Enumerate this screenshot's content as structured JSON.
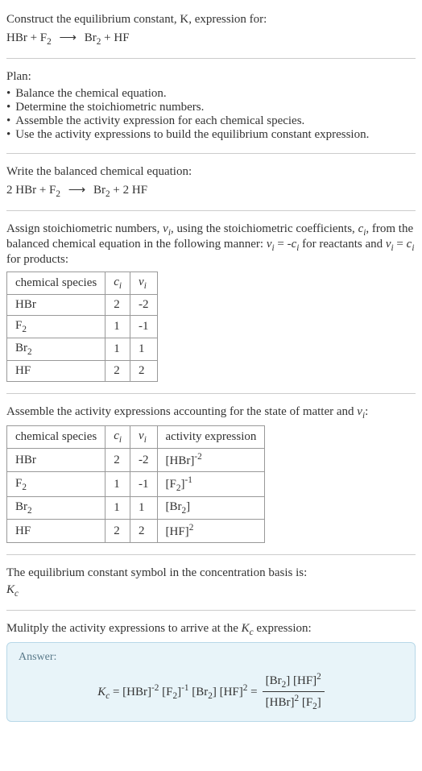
{
  "prompt": {
    "line1": "Construct the equilibrium constant, K, expression for:"
  },
  "plan": {
    "heading": "Plan:",
    "items": [
      "Balance the chemical equation.",
      "Determine the stoichiometric numbers.",
      "Assemble the activity expression for each chemical species.",
      "Use the activity expressions to build the equilibrium constant expression."
    ]
  },
  "balanced": {
    "heading": "Write the balanced chemical equation:"
  },
  "stoich": {
    "heading_pre": "Assign stoichiometric numbers, ",
    "heading_mid1": ", using the stoichiometric coefficients, ",
    "heading_mid2": ", from the balanced chemical equation in the following manner: ",
    "heading_r": " for reactants and ",
    "heading_p": " for products:",
    "table": {
      "headers": [
        "chemical species",
        "cᵢ",
        "νᵢ"
      ],
      "rows": [
        {
          "species": "HBr",
          "c": "2",
          "v": "-2"
        },
        {
          "species": "F₂",
          "c": "1",
          "v": "-1"
        },
        {
          "species": "Br₂",
          "c": "1",
          "v": "1"
        },
        {
          "species": "HF",
          "c": "2",
          "v": "2"
        }
      ]
    }
  },
  "activity": {
    "heading_pre": "Assemble the activity expressions accounting for the state of matter and ",
    "heading_post": ":",
    "table": {
      "headers": [
        "chemical species",
        "cᵢ",
        "νᵢ",
        "activity expression"
      ],
      "rows": [
        {
          "species": "HBr",
          "c": "2",
          "v": "-2"
        },
        {
          "species": "F₂",
          "c": "1",
          "v": "-1"
        },
        {
          "species": "Br₂",
          "c": "1",
          "v": "1"
        },
        {
          "species": "HF",
          "c": "2",
          "v": "2"
        }
      ]
    }
  },
  "basis": {
    "line1": "The equilibrium constant symbol in the concentration basis is:"
  },
  "multiply": {
    "line_pre": "Mulitply the activity expressions to arrive at the ",
    "line_post": " expression:"
  },
  "answer": {
    "label": "Answer:"
  }
}
